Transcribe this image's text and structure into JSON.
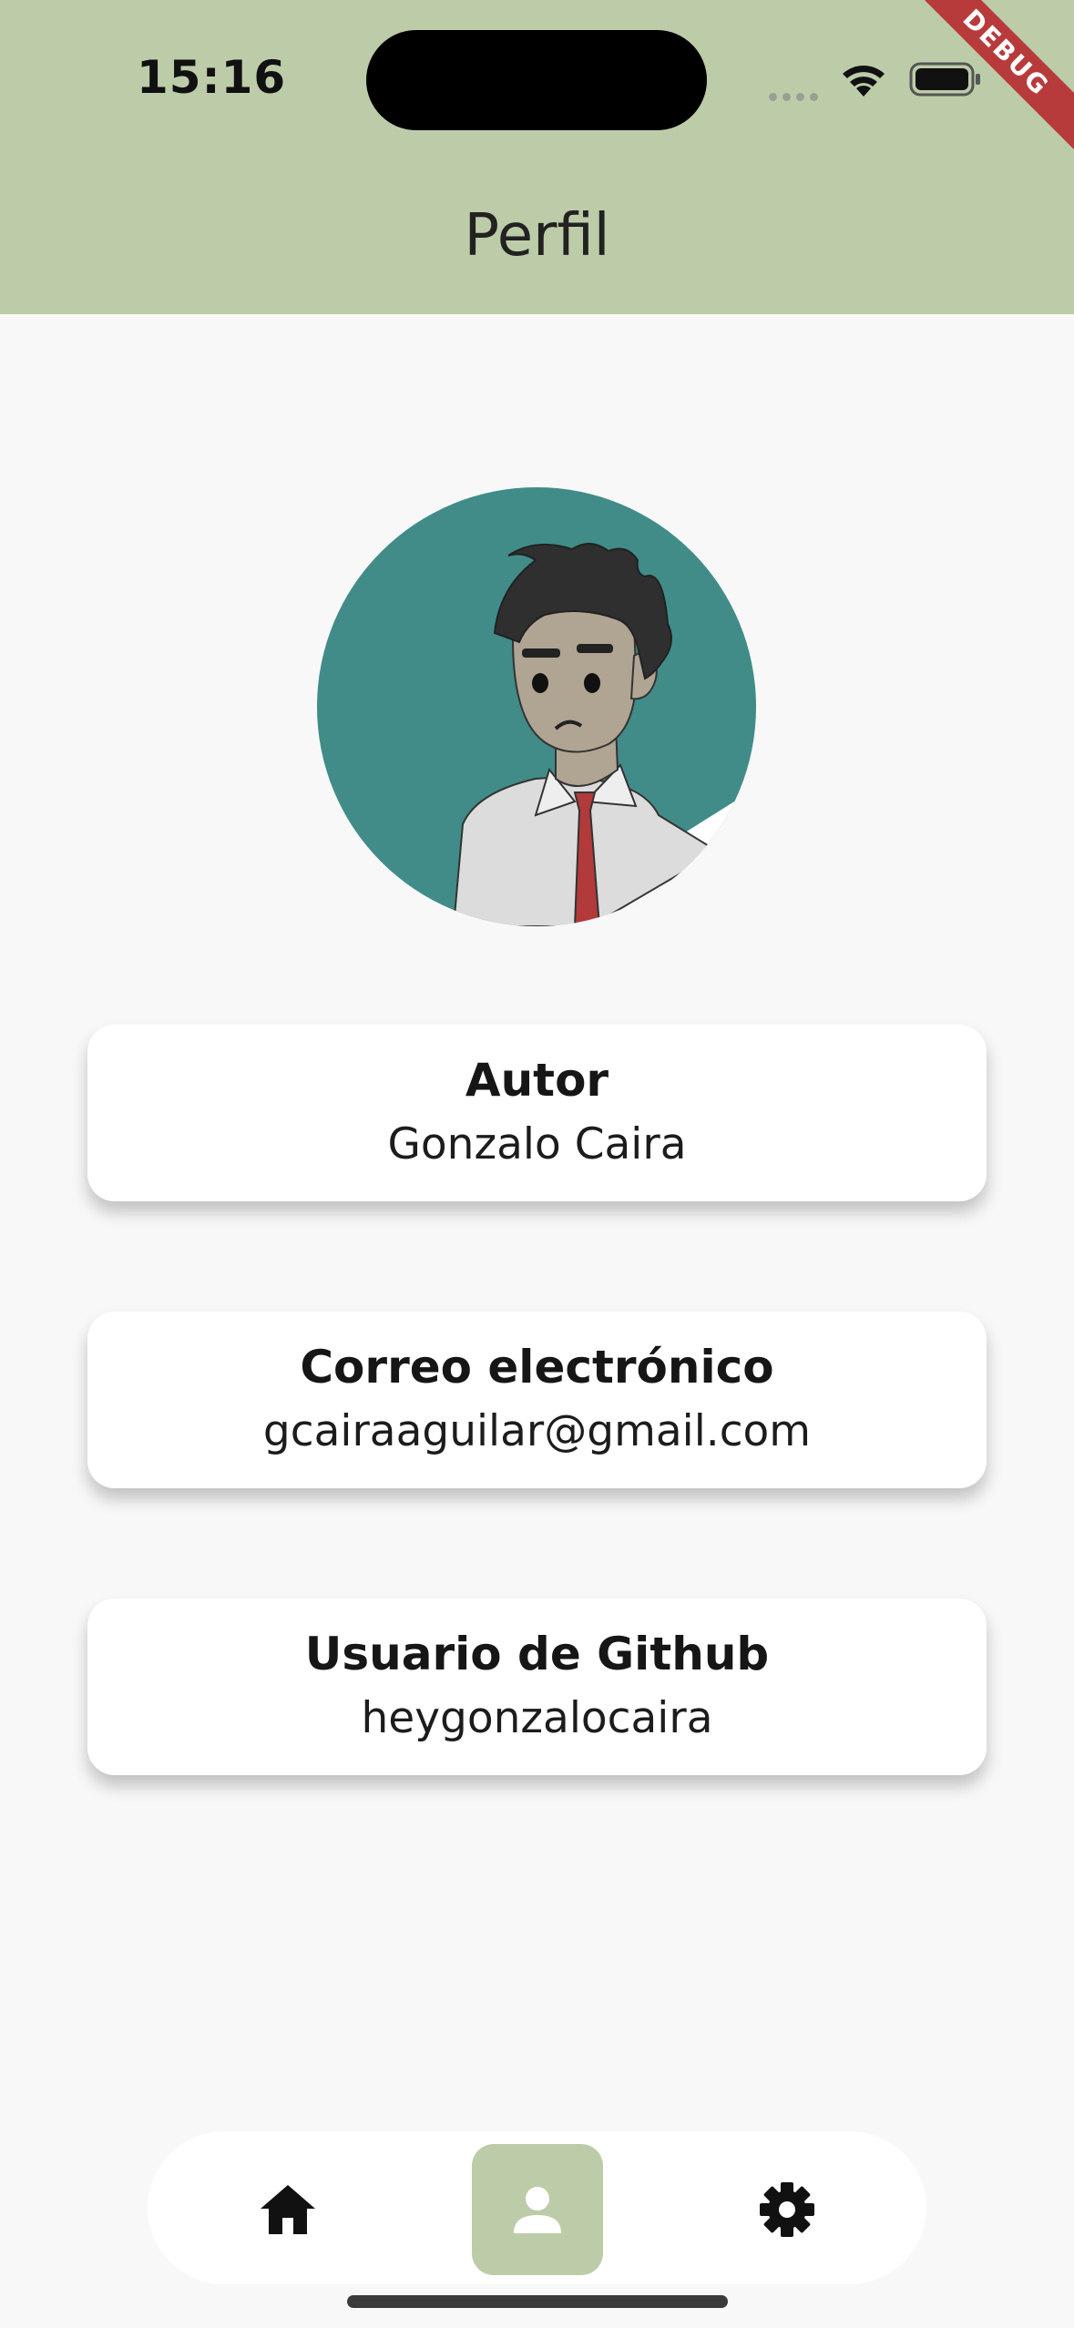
{
  "status_bar": {
    "time": "15:16"
  },
  "debug_banner": "DEBUG",
  "app_bar": {
    "title": "Perfil"
  },
  "profile": {
    "cards": [
      {
        "label": "Autor",
        "value": "Gonzalo Caira"
      },
      {
        "label": "Correo electrónico",
        "value": "gcairaaguilar@gmail.com"
      },
      {
        "label": "Usuario de Github",
        "value": "heygonzalocaira"
      }
    ]
  },
  "bottom_nav": {
    "items": [
      {
        "icon": "home-icon",
        "active": false
      },
      {
        "icon": "person-icon",
        "active": true
      },
      {
        "icon": "gear-icon",
        "active": false
      }
    ]
  },
  "colors": {
    "app_bar": "#bdcca8",
    "background": "#f8f8f8",
    "avatar_bg": "#418c88",
    "active_tab": "#bdcca8",
    "debug_banner": "#b83b3b"
  }
}
